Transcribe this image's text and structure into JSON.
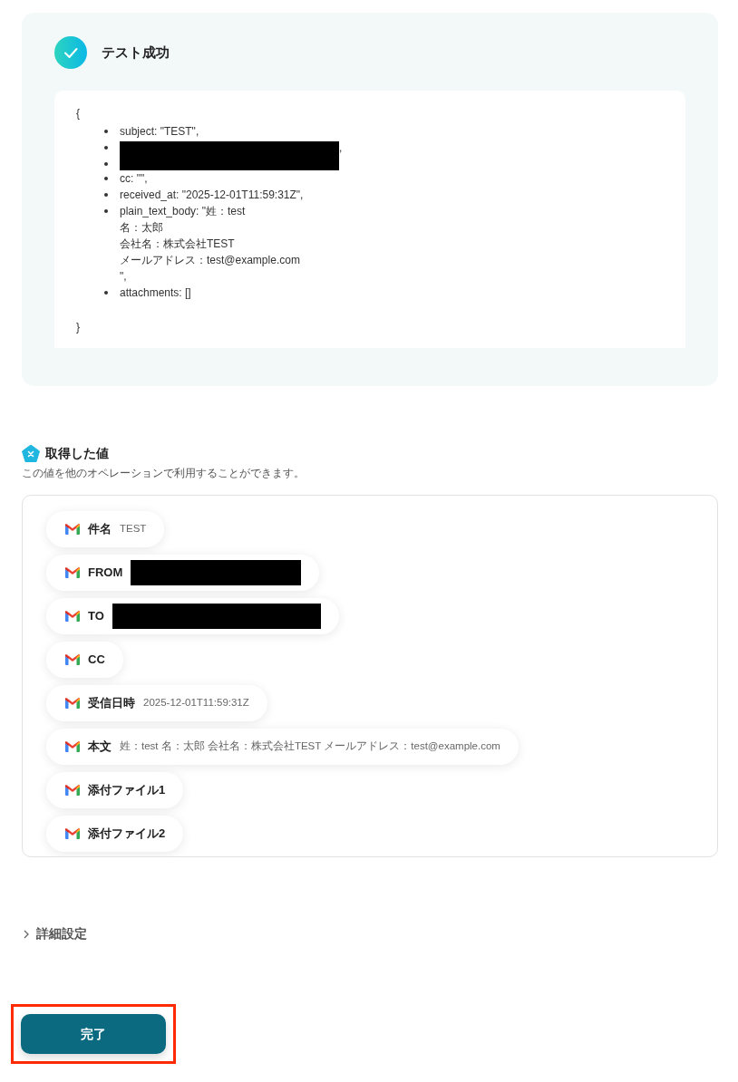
{
  "result": {
    "title": "テスト成功",
    "open_brace": "{",
    "close_brace": "}",
    "items": [
      {
        "kind": "text",
        "lines": [
          "subject: \"TEST\","
        ]
      },
      {
        "kind": "redacted",
        "suffix": ","
      },
      {
        "kind": "redacted"
      },
      {
        "kind": "text",
        "lines": [
          "cc: \"\","
        ]
      },
      {
        "kind": "text",
        "lines": [
          "received_at: \"2025-12-01T11:59:31Z\","
        ]
      },
      {
        "kind": "text",
        "lines": [
          "plain_text_body: \"姓：test",
          "名：太郎",
          "会社名：株式会社TEST",
          "メールアドレス：test@example.com",
          "\","
        ]
      },
      {
        "kind": "text",
        "lines": [
          "attachments: []"
        ]
      }
    ]
  },
  "values": {
    "title": "取得した値",
    "description": "この値を他のオペレーションで利用することができます。",
    "chips": [
      {
        "label": "件名",
        "kind": "text",
        "value": "TEST"
      },
      {
        "label": "FROM",
        "kind": "redacted"
      },
      {
        "label": "TO",
        "kind": "redacted"
      },
      {
        "label": "CC",
        "kind": "empty"
      },
      {
        "label": "受信日時",
        "kind": "text",
        "value": "2025-12-01T11:59:31Z"
      },
      {
        "label": "本文",
        "kind": "text",
        "value": "姓：test 名：太郎 会社名：株式会社TEST メールアドレス：test@example.com"
      },
      {
        "label": "添付ファイル1",
        "kind": "empty"
      },
      {
        "label": "添付ファイル2",
        "kind": "empty"
      }
    ]
  },
  "details": {
    "label": "詳細設定",
    "expanded": false
  },
  "done_button": {
    "label": "完了",
    "highlighted": true
  }
}
